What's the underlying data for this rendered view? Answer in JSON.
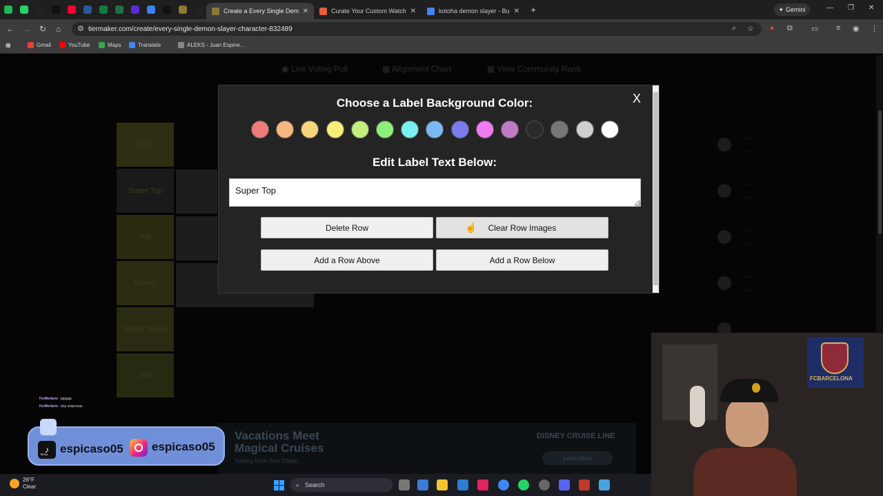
{
  "browser": {
    "tabs": [
      {
        "title": "Create a Every Single Demon Sl",
        "favicon_color": "#8a7a33",
        "active": true
      },
      {
        "title": "Curate Your Custom Watchlist |",
        "favicon_color": "#e85d3a",
        "active": false
      },
      {
        "title": "kotoha demon slayer - Buscar c",
        "favicon_color": "#4285f4",
        "active": false
      }
    ],
    "pinned_tab_colors": [
      "#1db954",
      "#25d366",
      "#222222",
      "#111111",
      "#ff0033",
      "#2b579a",
      "#107c41",
      "#1e7145",
      "#5b2bd8",
      "#3b82f6",
      "#111111",
      "#8a7a33",
      "#222222"
    ],
    "gemini_label": "Gemini",
    "url": "tiermaker.com/create/every-single-demon-slayer-character-832489",
    "bookmarks": [
      {
        "label": "Gmail",
        "color": "#ea4335"
      },
      {
        "label": "YouTube",
        "color": "#ff0000"
      },
      {
        "label": "Maps",
        "color": "#34a853"
      },
      {
        "label": "Translate",
        "color": "#4285f4"
      },
      {
        "label": "ALEKS - Juan Espine...",
        "color": "#888888"
      }
    ]
  },
  "page": {
    "nav": [
      "Live Voting Poll",
      "Alignment Chart",
      "View Community Rank"
    ],
    "tiers": [
      {
        "label": "NEW",
        "color": "#2e2e12"
      },
      {
        "label": "Super Top",
        "color": "#1a1a1a"
      },
      {
        "label": "Top",
        "color": "#2a2a10"
      },
      {
        "label": "Bueno",
        "color": "#2b2c11"
      },
      {
        "label": "Medio Medio",
        "color": "#2a2b12"
      },
      {
        "label": "Will",
        "color": "#252a10"
      }
    ],
    "ad": {
      "headline": "Vacations Meet Magical Cruises",
      "subline": "Sailing from San Diego",
      "brand": "DISNEY CRUISE LINE",
      "cta": "Learn More"
    }
  },
  "overlay": {
    "chat": [
      {
        "user": "FerMerlano",
        "msg": "jajajaja"
      },
      {
        "user": "FerMerlano",
        "msg": "doy sorpresas"
      }
    ],
    "social": {
      "tiktok_handle": "espicaso05",
      "instagram_handle": "espicaso05",
      "tiktok_caption": "TikTok"
    },
    "webcam_banner": "FCBARCELONA"
  },
  "modal": {
    "title": "Choose a Label Background Color:",
    "close_label": "X",
    "colors": [
      "#f07b7b",
      "#f5b97d",
      "#f7d57a",
      "#f6f07a",
      "#c3ef7d",
      "#8ef07b",
      "#7bf0f0",
      "#7bb9f5",
      "#7b7bf0",
      "#f07bf0",
      "#c07bc7",
      "#2a2a2a",
      "#777777",
      "#cfcfcf",
      "#ffffff"
    ],
    "edit_title": "Edit Label Text Below:",
    "label_text": "Super Top",
    "buttons": {
      "delete_row": "Delete Row",
      "clear_images": "Clear Row Images",
      "add_above": "Add a Row Above",
      "add_below": "Add a Row Below"
    }
  },
  "taskbar": {
    "weather_temp": "26°F",
    "weather_desc": "Clear",
    "search_label": "Search"
  }
}
